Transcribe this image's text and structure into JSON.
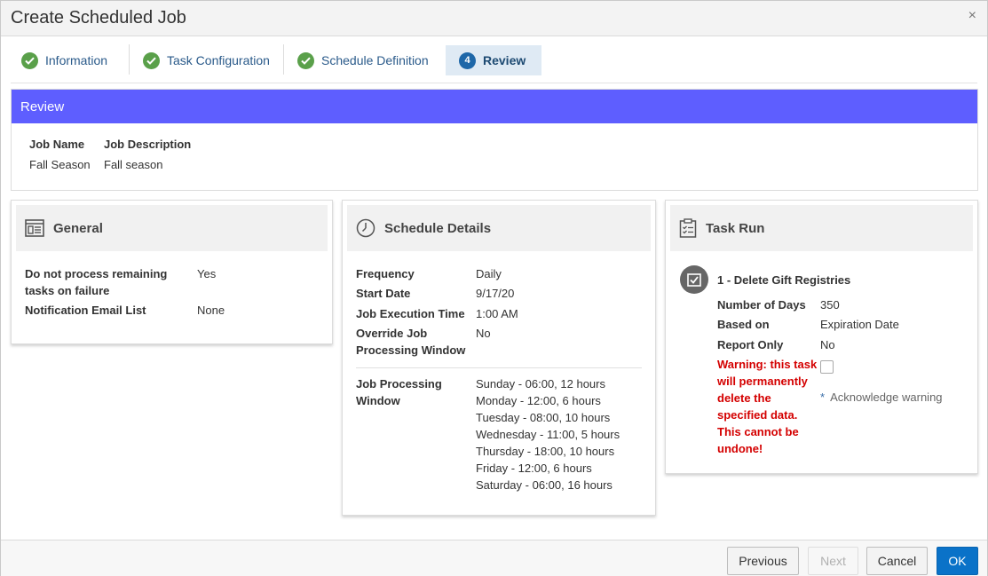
{
  "dialog": {
    "title": "Create Scheduled Job",
    "close_glyph": "×"
  },
  "train": {
    "steps": [
      {
        "label": "Information",
        "state": "complete"
      },
      {
        "label": "Task Configuration",
        "state": "complete"
      },
      {
        "label": "Schedule Definition",
        "state": "complete"
      },
      {
        "label": "Review",
        "state": "current",
        "number": "4"
      }
    ]
  },
  "review": {
    "heading": "Review",
    "job_name_label": "Job Name",
    "job_description_label": "Job Description",
    "job_name": "Fall Season",
    "job_description": "Fall season"
  },
  "general": {
    "title": "General",
    "icon": "form-icon",
    "rows": [
      {
        "label": "Do not process remaining tasks on failure",
        "value": "Yes"
      },
      {
        "label": "Notification Email List",
        "value": "None"
      }
    ]
  },
  "schedule": {
    "title": "Schedule Details",
    "icon": "clock-icon",
    "rows": [
      {
        "label": "Frequency",
        "value": "Daily"
      },
      {
        "label": "Start Date",
        "value": "9/17/20"
      },
      {
        "label": "Job Execution Time",
        "value": "1:00 AM"
      },
      {
        "label": "Override Job Processing Window",
        "value": "No"
      }
    ],
    "window_label": "Job Processing Window",
    "window_lines": [
      "Sunday - 06:00, 12 hours",
      "Monday - 12:00, 6 hours",
      "Tuesday - 08:00, 10 hours",
      "Wednesday - 11:00, 5 hours",
      "Thursday - 18:00, 10 hours",
      "Friday - 12:00, 6 hours",
      "Saturday - 06:00, 16 hours"
    ]
  },
  "task_run": {
    "title": "Task Run",
    "icon": "checklist-icon",
    "task_title": "1 - Delete Gift Registries",
    "task_icon": "checkbox-task-icon",
    "rows": [
      {
        "label": "Number of Days",
        "value": "350"
      },
      {
        "label": "Based on",
        "value": "Expiration Date"
      },
      {
        "label": "Report Only",
        "value": "No"
      }
    ],
    "warning": "Warning: this task will permanently delete the specified data. This cannot be undone!",
    "ack_required": "*",
    "ack_label": "Acknowledge warning"
  },
  "footer": {
    "previous": "Previous",
    "next": "Next",
    "cancel": "Cancel",
    "ok": "OK"
  },
  "colors": {
    "review_header": "#5e5eff",
    "check_green": "#5aa04a",
    "warning_red": "#d40000",
    "primary_button": "#0a72c8"
  }
}
